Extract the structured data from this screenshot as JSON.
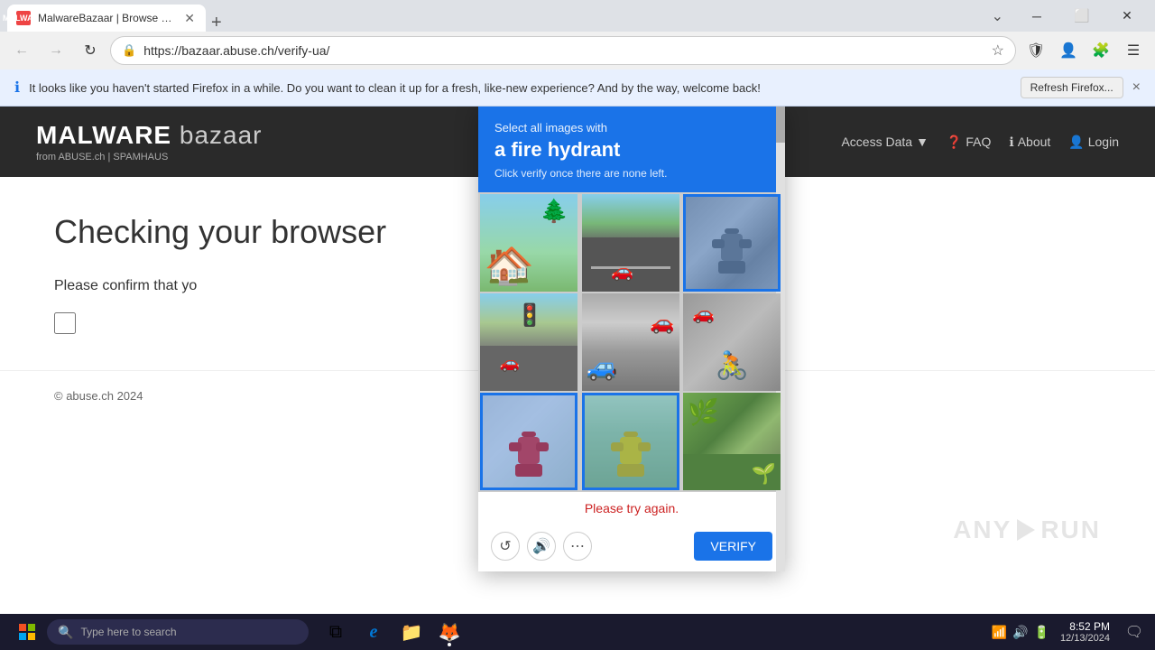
{
  "browser": {
    "tab_title": "MalwareBazaar | Browse Check...",
    "tab_favicon": "M",
    "url": "https://bazaar.abuse.ch/verify-ua/",
    "notification": {
      "text": "It looks like you haven't started Firefox in a while. Do you want to clean it up for a fresh, like-new experience? And by the way, welcome back!",
      "button_label": "Refresh Firefox...",
      "close_label": "×"
    }
  },
  "site": {
    "logo_bold": "MALWARE",
    "logo_light": " bazaar",
    "logo_sub": "from ABUSE.ch | SPAMHAUS",
    "nav_items": [
      {
        "label": "Access Data",
        "has_dropdown": true
      },
      {
        "label": "FAQ"
      },
      {
        "label": "About"
      },
      {
        "label": "Login"
      }
    ]
  },
  "page": {
    "heading": "Checking your browser",
    "confirm_text": "Please confirm that yo",
    "footer": "© abuse.ch 2024"
  },
  "captcha": {
    "instruction_prefix": "Select all images with",
    "instruction_subject": "a fire hydrant",
    "instruction_sub": "Click verify once there are none left.",
    "error_message": "Please try again.",
    "cells": [
      {
        "id": 1,
        "scene": "houses",
        "selected": false
      },
      {
        "id": 2,
        "scene": "highway",
        "selected": false
      },
      {
        "id": 3,
        "scene": "hydrant_gray",
        "selected": true
      },
      {
        "id": 4,
        "scene": "street",
        "selected": false
      },
      {
        "id": 5,
        "scene": "cars",
        "selected": false
      },
      {
        "id": 6,
        "scene": "bike",
        "selected": false
      },
      {
        "id": 7,
        "scene": "hydrant_red",
        "selected": true
      },
      {
        "id": 8,
        "scene": "hydrant_yellow",
        "selected": true
      },
      {
        "id": 9,
        "scene": "bush",
        "selected": false
      }
    ],
    "verify_button_label": "VERIFY",
    "refresh_title": "Get a new challenge",
    "audio_title": "Get an audio challenge",
    "info_title": "Help"
  },
  "taskbar": {
    "search_placeholder": "Type here to search",
    "time": "8:52 PM",
    "date": "12/13/2024",
    "apps": [
      {
        "name": "task-view",
        "icon": "⊞"
      },
      {
        "name": "edge",
        "icon": "e"
      },
      {
        "name": "file-explorer",
        "icon": "📁"
      },
      {
        "name": "firefox",
        "icon": "🦊",
        "active": true
      }
    ]
  }
}
